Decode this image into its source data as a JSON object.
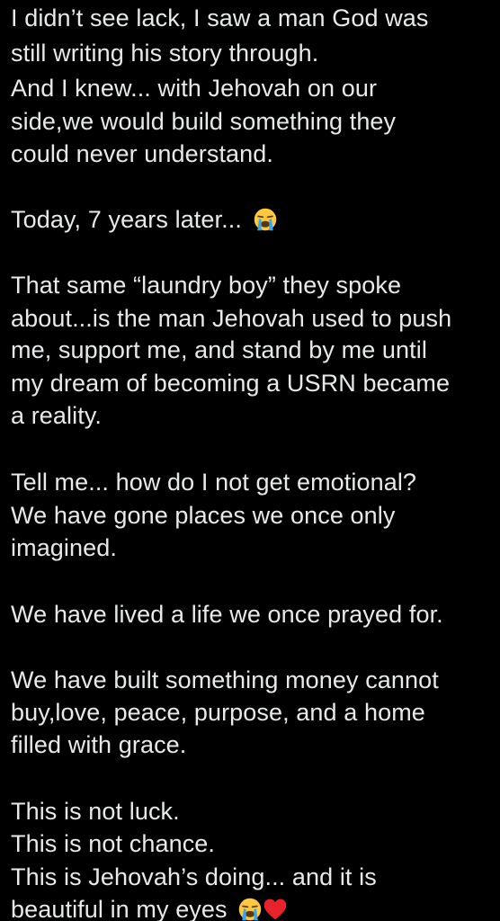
{
  "post": {
    "lines": [
      "I didn’t see lack, I saw a man God was",
      "still writing his story through.",
      "And I knew... with Jehovah on our",
      "side,we would build something they",
      "could never understand.",
      "Today, 7 years later...",
      "That same “laundry boy” they spoke",
      "about...is the man Jehovah used to push",
      "me, support me, and stand by me until",
      "my dream of becoming a USRN became",
      "a reality.",
      "Tell me... how do I not get emotional?",
      "We have gone places we once only",
      "imagined.",
      "We have lived a life we once prayed for.",
      "We have built something money cannot",
      "buy,love, peace, purpose, and a home",
      "filled with grace.",
      "This is not luck.",
      "This is not chance.",
      "This is Jehovah’s doing... and it is",
      "beautiful in my eyes"
    ],
    "emojis": {
      "crying": "loudly-crying-face-icon",
      "heart": "red-heart-icon"
    },
    "colors": {
      "background": "#000000",
      "text": "#e7e9ea",
      "heart": "#e8232b",
      "emoji_face": "#ffc83d",
      "tears": "#3aa6f0"
    }
  }
}
